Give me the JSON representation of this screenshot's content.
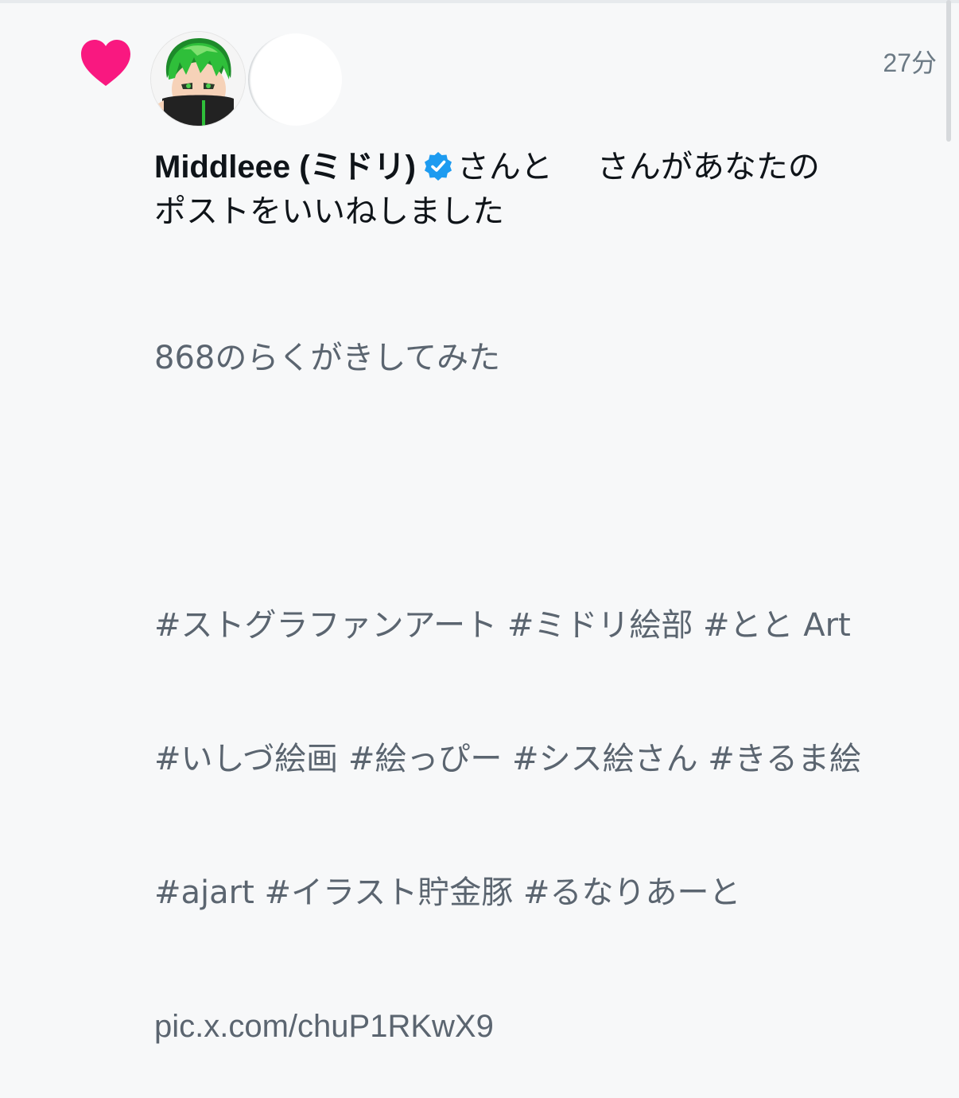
{
  "notification": {
    "timestamp": "27分",
    "actor_name": "Middleee (ミドリ)",
    "actor_verified": true,
    "headline_joiner": "さんと",
    "headline_rest": "さんがあなたの",
    "headline_line2": "ポストをいいねしました",
    "post": {
      "line1": "868のらくがきしてみた",
      "hashtags_line1": "#ストグラファンアート #ミドリ絵部 #とと Art",
      "hashtags_line2": "#いしづ絵画 #絵っぴー #シス絵さん #きるま絵",
      "hashtags_line3": "#ajart #イラスト貯金豚 #るなりあーと",
      "link": "pic.x.com/chuP1RKwX9"
    },
    "icons": {
      "like": "heart-icon",
      "verified": "verified-badge-icon"
    },
    "colors": {
      "heart": "#f91880",
      "verified": "#1d9bf0",
      "primary_text": "#0f1419",
      "secondary_text": "#5b6570"
    }
  }
}
